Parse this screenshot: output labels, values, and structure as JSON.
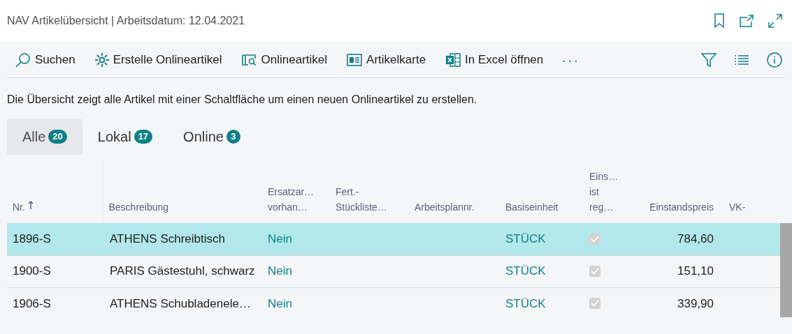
{
  "window": {
    "title": "NAV Artikelübersicht | Arbeitsdatum: 12.04.2021"
  },
  "toolbar": {
    "actions": [
      {
        "kind": "search",
        "label": "Suchen"
      },
      {
        "kind": "create",
        "label": "Erstelle Onlineartikel"
      },
      {
        "kind": "online",
        "label": "Onlineartikel"
      },
      {
        "kind": "card",
        "label": "Artikelkarte"
      },
      {
        "kind": "excel",
        "label": "In Excel öffnen"
      }
    ],
    "more": "···"
  },
  "description": "Die Übersicht zeigt alle Artikel mit einer Schaltfläche um einen neuen Onlineartikel zu erstellen.",
  "tabs": [
    {
      "label": "Alle",
      "count": "20",
      "selected": true
    },
    {
      "label": "Lokal",
      "count": "17",
      "selected": false
    },
    {
      "label": "Online",
      "count": "3",
      "selected": false
    }
  ],
  "table": {
    "columns": [
      {
        "label": "Nr.",
        "sorted": true
      },
      {
        "label": "Beschreibung"
      },
      {
        "label": "Ersatzar…\nvorhan…"
      },
      {
        "label": "Fert.-\nStückliste…"
      },
      {
        "label": "Arbeitsplannr."
      },
      {
        "label": "Basiseinheit"
      },
      {
        "label": "Eins…\nist\nreg…"
      },
      {
        "label": "Einstandspreis"
      },
      {
        "label": "VK-"
      }
    ],
    "rows": [
      {
        "selected": true,
        "no": "1896-S",
        "description": "ATHENS Schreibtisch",
        "substitutes": "Nein",
        "unit": "STÜCK",
        "checked": true,
        "unit_cost": "784,60"
      },
      {
        "selected": false,
        "no": "1900-S",
        "description": "PARIS Gästestuhl, schwarz",
        "substitutes": "Nein",
        "unit": "STÜCK",
        "checked": true,
        "unit_cost": "151,10"
      },
      {
        "selected": false,
        "no": "1906-S",
        "description": "ATHENS Schubladenele…",
        "substitutes": "Nein",
        "unit": "STÜCK",
        "checked": true,
        "unit_cost": "339,90"
      }
    ]
  }
}
